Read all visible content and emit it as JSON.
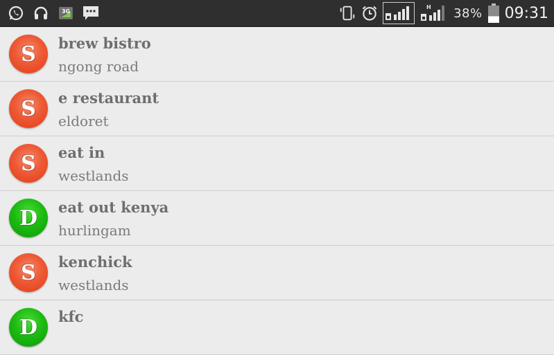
{
  "status_bar": {
    "left_icons": [
      "whatsapp-icon",
      "headphones-icon",
      "3g-data-icon",
      "message-icon"
    ],
    "right_icons": [
      "vibrate-icon",
      "alarm-icon",
      "signal-sim1-icon",
      "signal-sim2-icon",
      "battery-icon"
    ],
    "network_h_label": "H",
    "data_3g_label": "3G",
    "battery_percent": "38%",
    "battery_level": 0.38,
    "time": "09:31"
  },
  "colors": {
    "red_avatar": "#e8492a",
    "green_avatar": "#18b20e",
    "title_text": "#6e6e6e",
    "subtitle_text": "#7a7a7a",
    "background": "#ececec"
  },
  "items": [
    {
      "letter": "S",
      "color": "red",
      "title": "brew bistro",
      "subtitle": "ngong road"
    },
    {
      "letter": "S",
      "color": "red",
      "title": "e restaurant",
      "subtitle": "eldoret"
    },
    {
      "letter": "S",
      "color": "red",
      "title": "eat in",
      "subtitle": "westlands"
    },
    {
      "letter": "D",
      "color": "green",
      "title": "eat out kenya",
      "subtitle": "hurlingam"
    },
    {
      "letter": "S",
      "color": "red",
      "title": "kenchick",
      "subtitle": "westlands"
    },
    {
      "letter": "D",
      "color": "green",
      "title": "kfc",
      "subtitle": ""
    }
  ]
}
